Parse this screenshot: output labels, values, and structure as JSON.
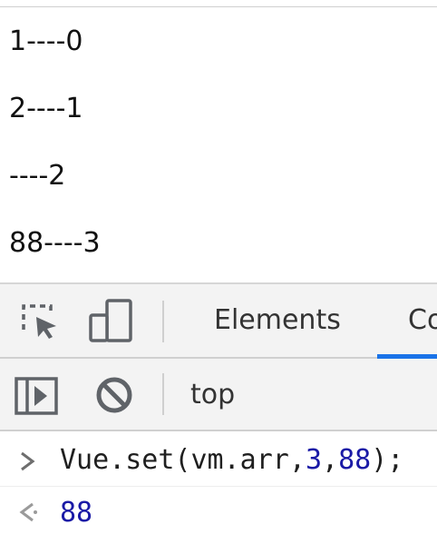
{
  "page_output": {
    "lines": [
      "1----0",
      "2----1",
      "----2",
      "88----3"
    ]
  },
  "devtools": {
    "tabs": {
      "elements_label": "Elements",
      "console_label": "Co",
      "active_tab": "Console"
    },
    "toolbar": {
      "context_label": "top"
    },
    "console": {
      "input": {
        "prefix": "Vue.set(vm.arr,",
        "arg_index": "3",
        "comma": ",",
        "arg_value": "88",
        "suffix": ");"
      },
      "result_value": "88"
    },
    "colors": {
      "accent": "#1a73e8",
      "number": "#1a1aa6",
      "panel_bg": "#f3f3f3"
    },
    "icons": [
      "inspect-element-icon",
      "device-toolbar-icon",
      "sidebar-toggle-icon",
      "clear-console-icon",
      "input-prompt-icon",
      "result-arrow-icon"
    ]
  }
}
